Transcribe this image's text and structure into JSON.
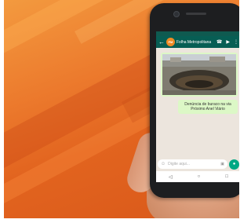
{
  "chat": {
    "title": "Folha Metropolitana",
    "avatar_text": "FM",
    "back_icon": "arrow-back-icon",
    "icons": [
      "phone-icon",
      "video-call-icon",
      "more-vertical-icon"
    ]
  },
  "messages": [
    {
      "type": "image",
      "alt": "road-crater-photo"
    },
    {
      "type": "text",
      "text": "Denúncia de buraco na via Próximo Anel Viário"
    }
  ],
  "composer": {
    "placeholder": "Digite aqui..."
  },
  "nav": [
    "back-nav-icon",
    "home-nav-icon",
    "recents-nav-icon"
  ],
  "colors": {
    "header": "#075e54",
    "bubble": "#dcf8c6",
    "chat_bg": "#ece5dd",
    "mic": "#00a884",
    "background": "#e8702a"
  }
}
